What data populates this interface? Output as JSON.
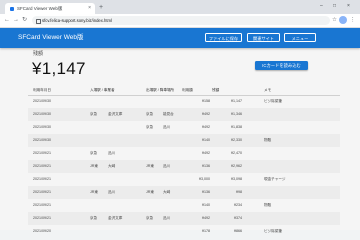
{
  "browser": {
    "tab_title": "SFCard Viewer Web版",
    "url": "sfcv.felica-support.sony.biz/index.html"
  },
  "app": {
    "title": "SFCard Viewer Web版",
    "buttons": {
      "save": "ファイルに保存",
      "support": "関連サイト",
      "menu": "メニュー"
    }
  },
  "balance": {
    "label": "残額",
    "amount": "¥1,147"
  },
  "show_all_button": "ICカードを読み込む",
  "table": {
    "headers": [
      "利用年月日",
      "入場駅 / 事業者",
      "",
      "出場駅 / 降車場所",
      "",
      "利用額",
      "残額",
      "メモ"
    ],
    "rows": [
      {
        "date": "2021/09/30",
        "t1": "",
        "s1": "",
        "t2": "",
        "s2": "",
        "amount": "¥158",
        "balance": "¥1,147",
        "memo": "ビジ除菜筆"
      },
      {
        "date": "2021/09/30",
        "t1": "京急",
        "s1": "金沢文庫",
        "t2": "京急",
        "s2": "能見台",
        "amount": "¥492",
        "balance": "¥1,346",
        "memo": ""
      },
      {
        "date": "2021/09/30",
        "t1": "",
        "s1": "",
        "t2": "京急",
        "s2": "品川",
        "amount": "¥492",
        "balance": "¥1,838",
        "memo": ""
      },
      {
        "date": "2021/09/30",
        "t1": "",
        "s1": "",
        "t2": "",
        "s2": "",
        "amount": "¥140",
        "balance": "¥2,330",
        "memo": "物販"
      },
      {
        "date": "2021/09/21",
        "t1": "京急",
        "s1": "品川",
        "t2": "",
        "s2": "",
        "amount": "¥492",
        "balance": "¥2,470",
        "memo": ""
      },
      {
        "date": "2021/09/21",
        "t1": "JR東",
        "s1": "大崎",
        "t2": "JR東",
        "s2": "品川",
        "amount": "¥136",
        "balance": "¥2,962",
        "memo": ""
      },
      {
        "date": "2021/09/21",
        "t1": "",
        "s1": "",
        "t2": "",
        "s2": "",
        "amount": "¥3,000",
        "balance": "¥3,098",
        "memo": "現金チャージ"
      },
      {
        "date": "2021/09/21",
        "t1": "JR東",
        "s1": "品川",
        "t2": "JR東",
        "s2": "大崎",
        "amount": "¥136",
        "balance": "¥98",
        "memo": ""
      },
      {
        "date": "2021/09/21",
        "t1": "",
        "s1": "",
        "t2": "",
        "s2": "",
        "amount": "¥140",
        "balance": "¥234",
        "memo": "物販"
      },
      {
        "date": "2021/09/21",
        "t1": "京急",
        "s1": "金沢文庫",
        "t2": "京急",
        "s2": "品川",
        "amount": "¥492",
        "balance": "¥374",
        "memo": ""
      },
      {
        "date": "2021/09/20",
        "t1": "",
        "s1": "",
        "t2": "",
        "s2": "",
        "amount": "¥178",
        "balance": "¥866",
        "memo": "ビジ除菜筆"
      }
    ]
  }
}
